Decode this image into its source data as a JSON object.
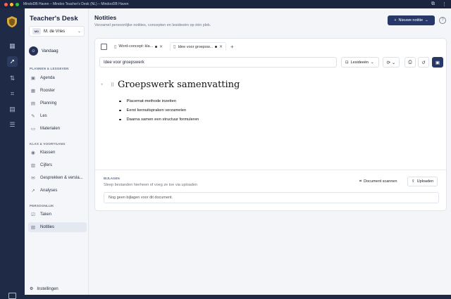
{
  "window": {
    "title": "MindoDB Haven – Mindoo Teacher's Desk (NL) – MindooDB Haven"
  },
  "brand": {
    "name": "Teacher's Desk",
    "logo_alt": "shield-logo"
  },
  "user": {
    "initials": "MD",
    "name": "M. de Vries"
  },
  "sidebar": {
    "today": "Vandaag",
    "sections": [
      {
        "label": "PLANNEN & LESGEVEN",
        "items": [
          {
            "label": "Agenda",
            "icon": "calendar-icon"
          },
          {
            "label": "Rooster",
            "icon": "grid-icon"
          },
          {
            "label": "Planning",
            "icon": "planning-icon"
          },
          {
            "label": "Les",
            "icon": "lesson-icon"
          },
          {
            "label": "Materialen",
            "icon": "folder-icon"
          }
        ]
      },
      {
        "label": "KLAS & VOORTGANG",
        "items": [
          {
            "label": "Klassen",
            "icon": "users-icon"
          },
          {
            "label": "Cijfers",
            "icon": "chart-icon"
          },
          {
            "label": "Gesprekken & versla...",
            "icon": "chat-icon"
          },
          {
            "label": "Analyses",
            "icon": "analytics-icon"
          }
        ]
      },
      {
        "label": "PERSOONLIJK",
        "items": [
          {
            "label": "Taken",
            "icon": "tasks-icon"
          },
          {
            "label": "Notities",
            "icon": "notes-icon"
          }
        ]
      }
    ],
    "settings": "Instellingen"
  },
  "main": {
    "title": "Notities",
    "subtitle": "Verzamel persoonlijke notities, concepten en lesideeën op één plek.",
    "new_button": "Nieuwe notitie",
    "tabs": [
      {
        "label": "Word-concept: kla...",
        "selected": false
      },
      {
        "label": "Idee voor groepsw...",
        "selected": true
      }
    ],
    "note_title": "Idee voor groepswerk",
    "category": "Lesideeën",
    "editor": {
      "heading": "Groepswerk samenvatting",
      "bullets": [
        "Placemat-methode inzetten",
        "Eerst kernuitspraken verzamelen",
        "Daarna samen een structuur formuleren"
      ]
    },
    "attachments": {
      "label": "BIJLAGEN",
      "hint": "Sleep bestanden hierheen of voeg ze toe via uploaden",
      "scan_button": "Document scannen",
      "upload_button": "Uploaden",
      "empty": "Nog geen bijlagen voor dit document."
    }
  },
  "colors": {
    "accent": "#273768",
    "rail": "#1f2a47"
  }
}
